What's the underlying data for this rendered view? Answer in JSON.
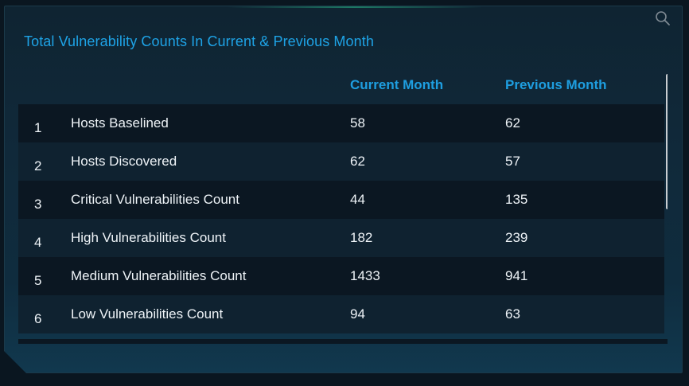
{
  "panel": {
    "title": "Total Vulnerability Counts In Current & Previous Month"
  },
  "table": {
    "columns": [
      "",
      "",
      "Current Month",
      "Previous Month"
    ],
    "rows": [
      {
        "num": "1",
        "name": "Hosts Baselined",
        "current": "58",
        "previous": "62"
      },
      {
        "num": "2",
        "name": "Hosts Discovered",
        "current": "62",
        "previous": "57"
      },
      {
        "num": "3",
        "name": "Critical Vulnerabilities Count",
        "current": "44",
        "previous": "135"
      },
      {
        "num": "4",
        "name": "High Vulnerabilities Count",
        "current": "182",
        "previous": "239"
      },
      {
        "num": "5",
        "name": "Medium Vulnerabilities Count",
        "current": "1433",
        "previous": "941"
      },
      {
        "num": "6",
        "name": "Low Vulnerabilities Count",
        "current": "94",
        "previous": "63"
      }
    ]
  },
  "icons": {
    "search": "search-icon"
  },
  "colors": {
    "accent": "#1ea3e6",
    "header_text": "#1e9ee0",
    "row_odd": "#0b1722",
    "row_even": "#0f2230"
  }
}
